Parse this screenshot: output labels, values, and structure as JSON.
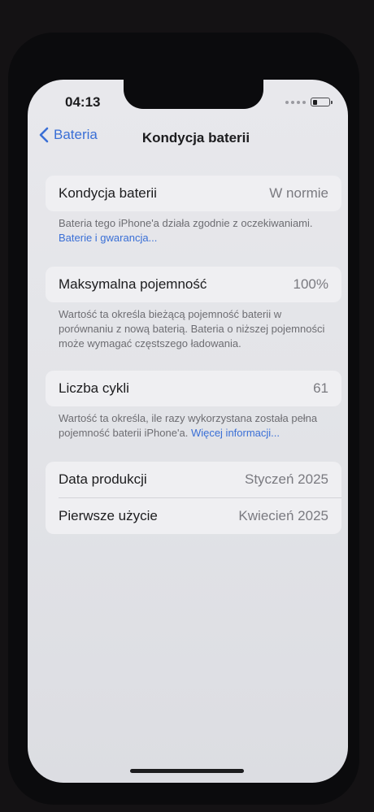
{
  "status_bar": {
    "time": "04:13"
  },
  "nav": {
    "back_label": "Bateria",
    "title": "Kondycja baterii"
  },
  "battery_health": {
    "label": "Kondycja baterii",
    "value": "W normie",
    "note": "Bateria tego iPhone'a działa zgodnie z oczekiwaniami.",
    "link": "Baterie i gwarancja..."
  },
  "max_capacity": {
    "label": "Maksymalna pojemność",
    "value": "100%",
    "note": "Wartość ta określa bieżącą pojemność baterii w porównaniu z nową baterią. Bateria o niższej pojemności może wymagać częstszego ładowania."
  },
  "cycle_count": {
    "label": "Liczba cykli",
    "value": "61",
    "note": "Wartość ta określa, ile razy wykorzystana została pełna pojemność baterii iPhone'a.",
    "link": "Więcej informacji..."
  },
  "dates": {
    "manufacture_label": "Data produkcji",
    "manufacture_value": "Styczeń 2025",
    "first_use_label": "Pierwsze użycie",
    "first_use_value": "Kwiecień 2025"
  },
  "colors": {
    "accent": "#3a6fd6",
    "background": "#e6e6ea",
    "cell": "#efeff2"
  }
}
